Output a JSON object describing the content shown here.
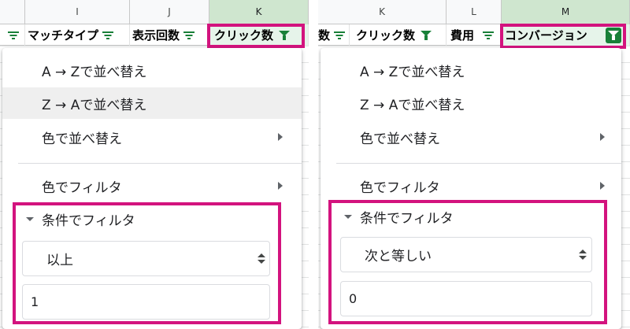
{
  "left": {
    "columns": [
      "I",
      "J",
      "K"
    ],
    "headers": [
      {
        "text": "マッチタイプ"
      },
      {
        "text": "表示回数"
      },
      {
        "text": "クリック数"
      }
    ],
    "menu": {
      "sort_az": "A → Zで並べ替え",
      "sort_za": "Z → Aで並べ替え",
      "sort_color": "色で並べ替え",
      "filter_color": "色でフィルタ",
      "filter_condition": "条件でフィルタ",
      "condition_value": "以上",
      "input_value": "1"
    }
  },
  "right": {
    "columns": [
      "K",
      "L",
      "M"
    ],
    "headers": [
      {
        "text": "数"
      },
      {
        "text": "クリック数"
      },
      {
        "text": "費用"
      },
      {
        "text": "コンバージョン"
      }
    ],
    "menu": {
      "sort_az": "A → Zで並べ替え",
      "sort_za": "Z → Aで並べ替え",
      "sort_color": "色で並べ替え",
      "filter_color": "色でフィルタ",
      "filter_condition": "条件でフィルタ",
      "condition_value": "次と等しい",
      "input_value": "0"
    }
  },
  "colors": {
    "highlight": "#d3137e",
    "filter_green": "#188038",
    "selected_header": "#cfe6cf"
  },
  "icons": [
    "filter-lines-icon",
    "filter-funnel-icon",
    "chevron-right-icon",
    "caret-down-icon",
    "select-updown-icon"
  ]
}
